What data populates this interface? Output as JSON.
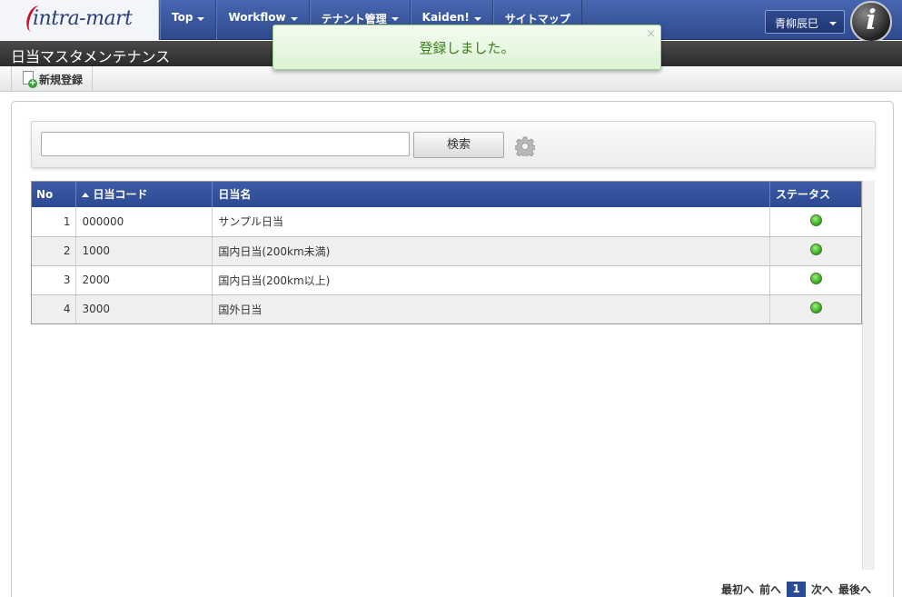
{
  "header": {
    "logo": "intra-mart",
    "nav": [
      {
        "label": "Top",
        "dropdown": true
      },
      {
        "label": "Workflow",
        "dropdown": true
      },
      {
        "label": "テナント管理",
        "dropdown": true
      },
      {
        "label": "Kaiden!",
        "dropdown": true
      },
      {
        "label": "サイトマップ",
        "dropdown": false
      }
    ],
    "user_name": "青柳辰巳"
  },
  "page_title": "日当マスタメンテナンス",
  "toolbar": {
    "new_label": "新規登録"
  },
  "toast": {
    "message": "登録しました。",
    "close": "×"
  },
  "search": {
    "value": "",
    "button_label": "検索"
  },
  "table": {
    "columns": [
      "No",
      "日当コード",
      "日当名",
      "ステータス"
    ],
    "sort_column": "日当コード",
    "rows": [
      {
        "no": "1",
        "code": "000000",
        "name": "サンプル日当",
        "status": "active"
      },
      {
        "no": "2",
        "code": "1000",
        "name": "国内日当(200km未満)",
        "status": "active"
      },
      {
        "no": "3",
        "code": "2000",
        "name": "国内日当(200km以上)",
        "status": "active"
      },
      {
        "no": "4",
        "code": "3000",
        "name": "国外日当",
        "status": "active"
      }
    ]
  },
  "pager": {
    "first": "最初へ",
    "prev": "前へ",
    "current": "1",
    "next": "次へ",
    "last": "最後へ"
  },
  "colors": {
    "nav_blue": "#2f4a8e",
    "toast_text": "#3b7d1d",
    "status_green": "#2ea512"
  }
}
